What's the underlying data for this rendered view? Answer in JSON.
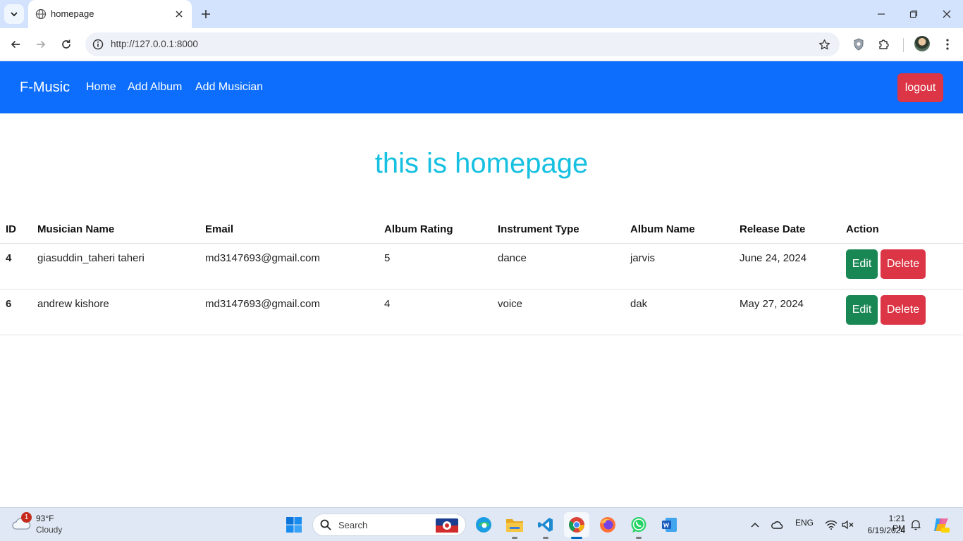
{
  "browser": {
    "tab_title": "homepage",
    "url": "http://127.0.0.1:8000"
  },
  "navbar": {
    "brand": "F-Music",
    "links": [
      "Home",
      "Add Album",
      "Add Musician"
    ],
    "logout_label": "logout",
    "bg_color": "#0d6efd"
  },
  "main": {
    "heading": "this is homepage",
    "heading_color": "#16c0e0",
    "table": {
      "headers": [
        "ID",
        "Musician Name",
        "Email",
        "Album Rating",
        "Instrument Type",
        "Album Name",
        "Release Date",
        "Action"
      ],
      "rows": [
        {
          "id": "4",
          "musician_name": "giasuddin_taheri taheri",
          "email": "md3147693@gmail.com",
          "album_rating": "5",
          "instrument_type": "dance",
          "album_name": "jarvis",
          "release_date": "June 24, 2024",
          "edit_label": "Edit",
          "delete_label": "Delete"
        },
        {
          "id": "6",
          "musician_name": "andrew kishore",
          "email": "md3147693@gmail.com",
          "album_rating": "4",
          "instrument_type": "voice",
          "album_name": "dak",
          "release_date": "May 27, 2024",
          "edit_label": "Edit",
          "delete_label": "Delete"
        }
      ]
    }
  },
  "taskbar": {
    "weather_badge": "1",
    "weather_temp": "93°F",
    "weather_condition": "Cloudy",
    "search_label": "Search",
    "language": "ENG",
    "time": "1:21 PM",
    "date": "6/19/2024"
  }
}
